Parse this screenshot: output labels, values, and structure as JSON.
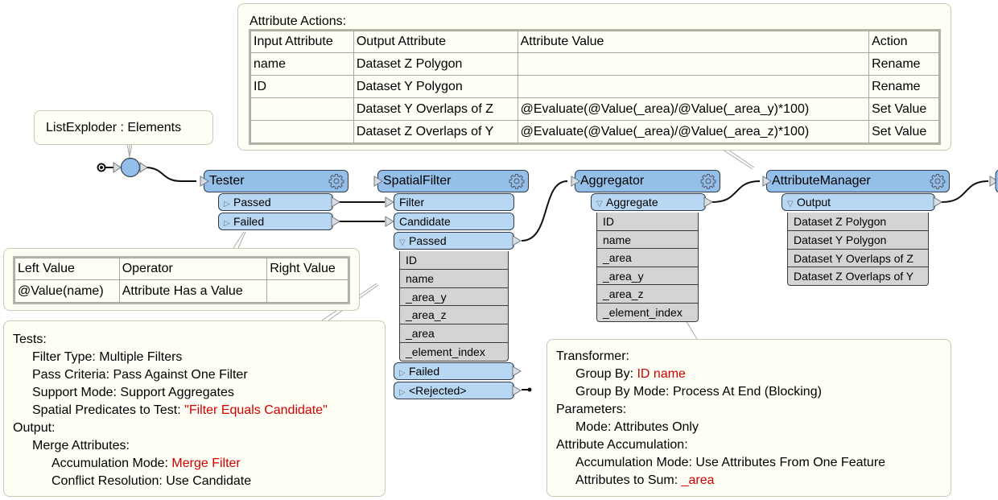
{
  "annotations": {
    "attribute_actions": {
      "title": "Attribute Actions:",
      "headers": [
        "Input Attribute",
        "Output Attribute",
        "Attribute Value",
        "Action"
      ],
      "rows": [
        [
          "name",
          "Dataset Z Polygon",
          "",
          "Rename"
        ],
        [
          "ID",
          "Dataset Y Polygon",
          "",
          "Rename"
        ],
        [
          "",
          "Dataset Y Overlaps of Z",
          "@Evaluate(@Value(_area)/@Value(_area_y)*100)",
          "Set Value"
        ],
        [
          "",
          "Dataset Z Overlaps of Y",
          "@Evaluate(@Value(_area)/@Value(_area_z)*100)",
          "Set Value"
        ]
      ]
    },
    "list_exploder": {
      "text": "ListExploder : Elements"
    },
    "tester_table": {
      "headers": [
        "Left Value",
        "Operator",
        "Right Value"
      ],
      "rows": [
        [
          "@Value(name)",
          "Attribute Has a Value",
          ""
        ]
      ]
    },
    "spatial_filter": {
      "lines": [
        {
          "indent": 0,
          "text": "Tests:"
        },
        {
          "indent": 1,
          "text": "Filter Type: Multiple Filters"
        },
        {
          "indent": 1,
          "text": "Pass Criteria: Pass Against One Filter"
        },
        {
          "indent": 1,
          "text": "Support Mode: Support Aggregates"
        },
        {
          "indent": 1,
          "text": "Spatial Predicates to Test: ",
          "value": "\"Filter Equals Candidate\""
        },
        {
          "indent": 0,
          "text": "Output:"
        },
        {
          "indent": 1,
          "text": "Merge Attributes:"
        },
        {
          "indent": 2,
          "text": "Accumulation Mode: ",
          "value": "Merge Filter"
        },
        {
          "indent": 2,
          "text": "Conflict Resolution: Use Candidate"
        }
      ]
    },
    "aggregator": {
      "lines": [
        {
          "indent": 0,
          "text": "Transformer:"
        },
        {
          "indent": 1,
          "text": "Group By: ",
          "value": "ID name"
        },
        {
          "indent": 1,
          "text": "Group By Mode: Process At End (Blocking)"
        },
        {
          "indent": 0,
          "text": "Parameters:"
        },
        {
          "indent": 1,
          "text": "Mode: Attributes Only"
        },
        {
          "indent": 0,
          "text": "Attribute Accumulation:"
        },
        {
          "indent": 1,
          "text": "Accumulation Mode: Use Attributes From One Feature"
        },
        {
          "indent": 1,
          "text": "Attributes to Sum: ",
          "value": "_area"
        }
      ]
    }
  },
  "nodes": [
    {
      "id": "tester",
      "title": "Tester",
      "icon": "gear-icon",
      "rows": [
        {
          "type": "output",
          "label": "Passed",
          "expander": "collapsed"
        },
        {
          "type": "output",
          "label": "Failed",
          "expander": "collapsed"
        }
      ]
    },
    {
      "id": "spatialfilter",
      "title": "SpatialFilter",
      "icon": "gear-icon",
      "rows": [
        {
          "type": "input",
          "label": "Filter"
        },
        {
          "type": "input",
          "label": "Candidate"
        },
        {
          "type": "output",
          "label": "Passed",
          "expander": "expanded"
        },
        {
          "type": "attrs",
          "items": [
            "ID",
            "name",
            "_area_y",
            "_area_z",
            "_area",
            "_element_index"
          ]
        },
        {
          "type": "output",
          "label": "Failed",
          "expander": "collapsed"
        },
        {
          "type": "output",
          "label": "<Rejected>",
          "expander": "collapsed"
        }
      ]
    },
    {
      "id": "aggregator",
      "title": "Aggregator",
      "icon": "gear-icon",
      "rows": [
        {
          "type": "output",
          "label": "Aggregate",
          "expander": "expanded"
        },
        {
          "type": "attrs",
          "items": [
            "ID",
            "name",
            "_area",
            "_area_y",
            "_area_z",
            "_element_index"
          ]
        }
      ]
    },
    {
      "id": "attributemanager",
      "title": "AttributeManager",
      "icon": "gear-icon",
      "rows": [
        {
          "type": "output",
          "label": "Output",
          "expander": "expanded"
        },
        {
          "type": "attrs",
          "items": [
            "Dataset Z Polygon",
            "Dataset Y Polygon",
            "Dataset Y Overlaps of Z",
            "Dataset Z Overlaps of Y"
          ]
        }
      ]
    }
  ],
  "colors": {
    "node_header": "#94bfe8",
    "port": "#b8d7f3",
    "attribute_row": "#d4d4d4",
    "annotation_bg": "#fefef4",
    "highlight_text": "#d20000"
  }
}
